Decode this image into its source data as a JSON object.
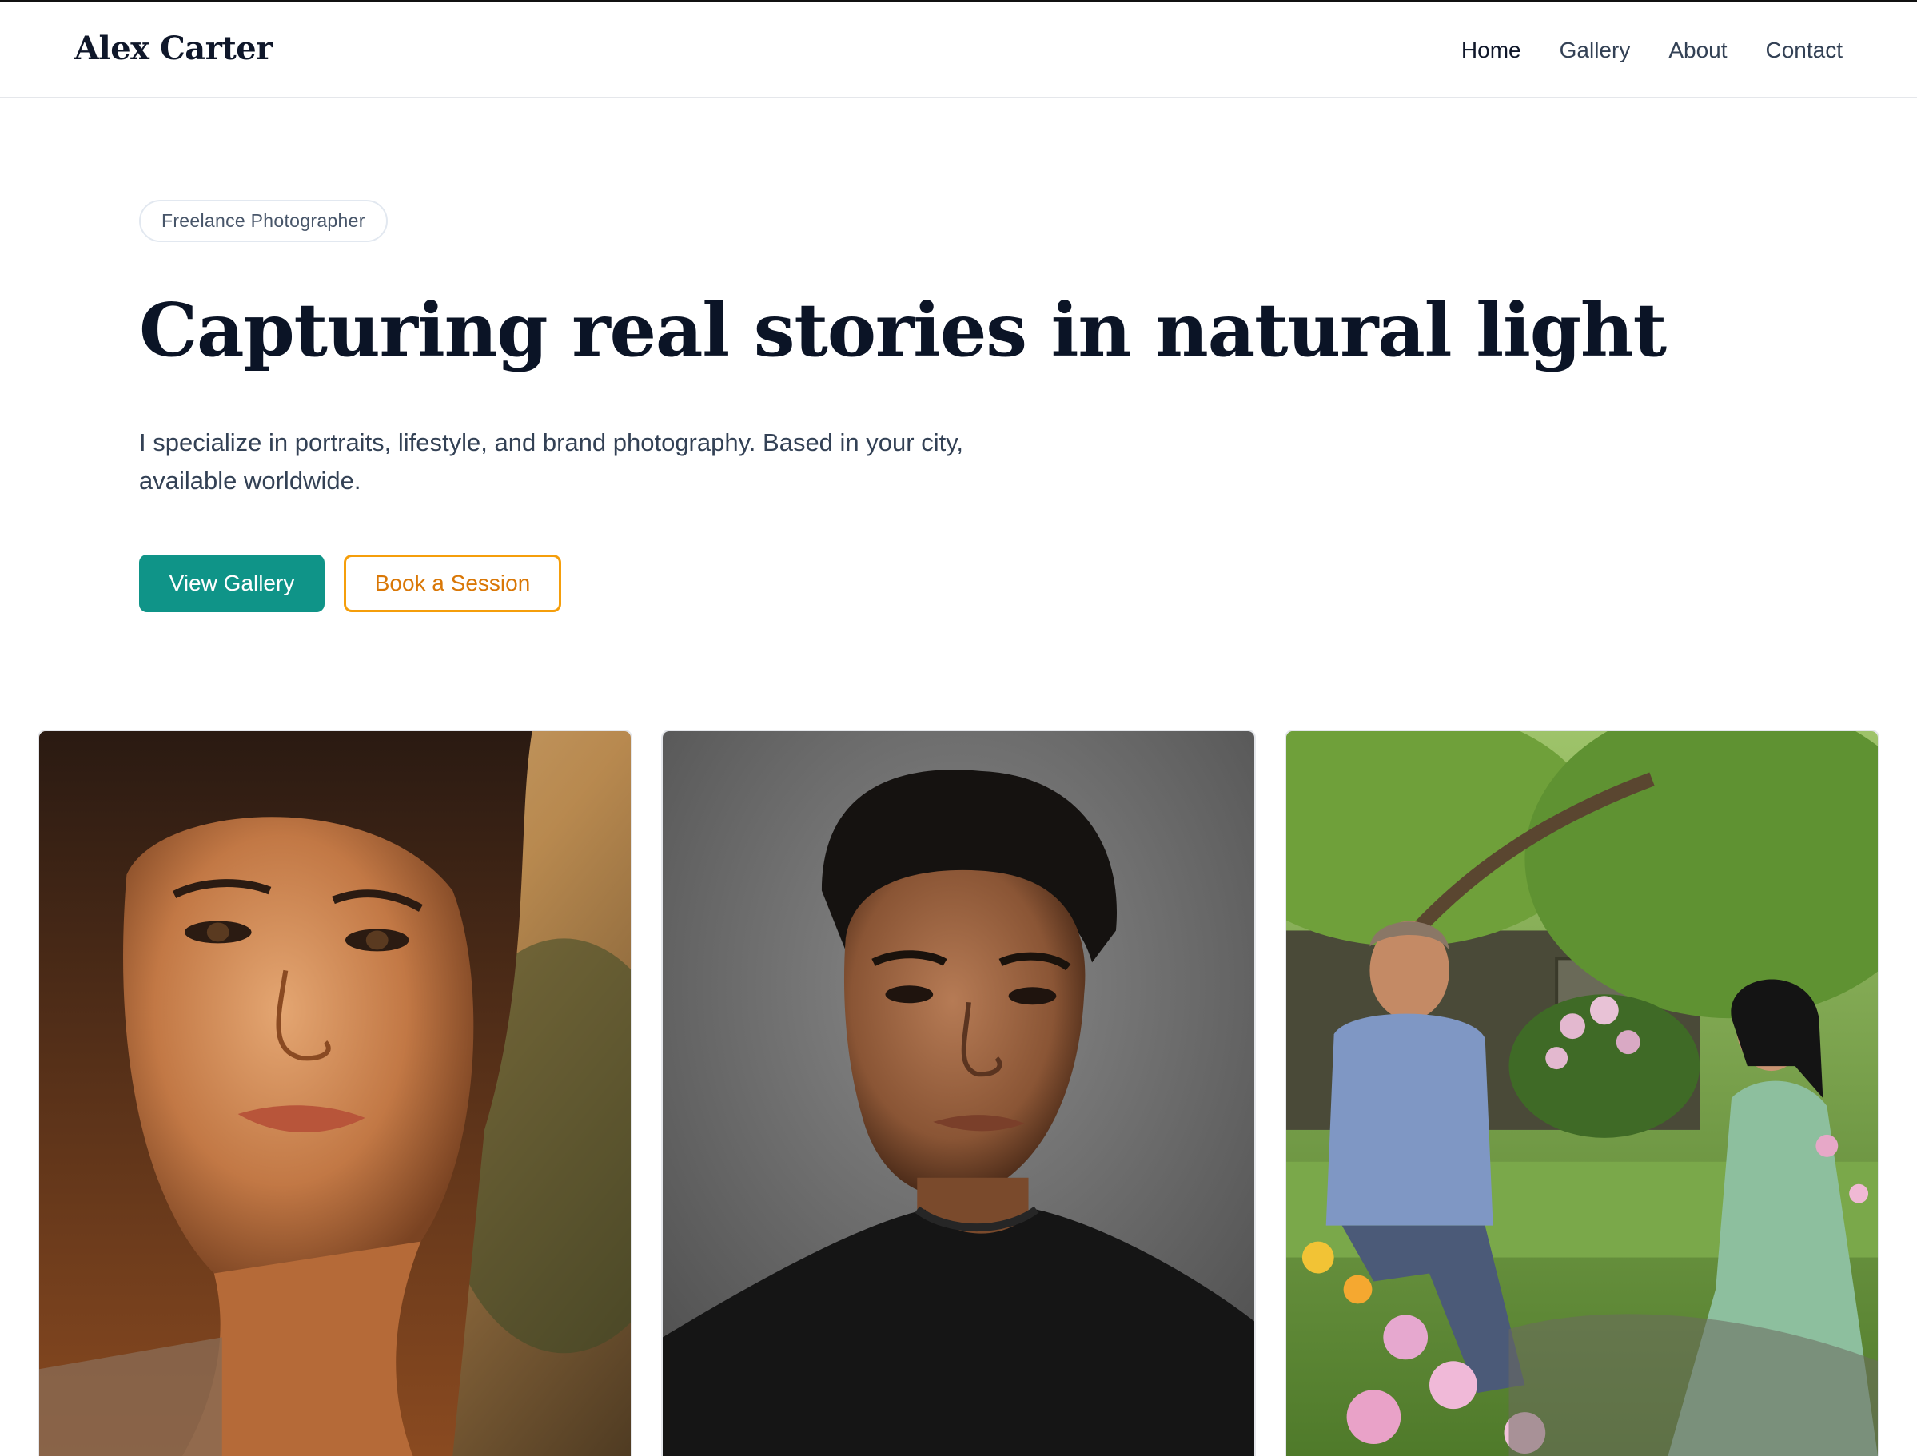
{
  "header": {
    "brand": "Alex Carter",
    "nav": [
      {
        "label": "Home",
        "active": true
      },
      {
        "label": "Gallery",
        "active": false
      },
      {
        "label": "About",
        "active": false
      },
      {
        "label": "Contact",
        "active": false
      }
    ]
  },
  "hero": {
    "badge": "Freelance Photographer",
    "headline": "Capturing real stories in natural light",
    "lede": "I specialize in portraits, lifestyle, and brand photography. Based in your city, available worldwide.",
    "primary_cta": "View Gallery",
    "secondary_cta": "Book a Session"
  },
  "gallery": {
    "photos": [
      {
        "subject": "woman-golden-hour-portrait"
      },
      {
        "subject": "young-man-studio-portrait"
      },
      {
        "subject": "couple-in-garden"
      }
    ]
  },
  "colors": {
    "primary": "#0f9488",
    "accent": "#f59e0b",
    "accent_text": "#d97706",
    "heading": "#0b1426",
    "body": "#334155"
  }
}
